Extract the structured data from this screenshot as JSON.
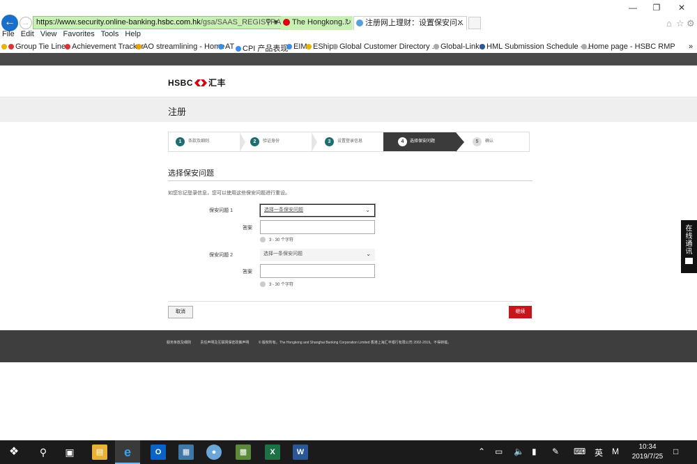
{
  "browser": {
    "url_prefix": "https://www.security.online-banking.",
    "url_host": "hsbc.com.hk",
    "url_rest": "/gsa/SAAS_REGISTRATI",
    "tab1_label": "The Hongkong...",
    "tab2_label": "注册网上理财：设置保安问...",
    "menu": [
      "File",
      "Edit",
      "View",
      "Favorites",
      "Tools",
      "Help"
    ],
    "favorites": [
      "Group Tie Lines",
      "Achievement Tracker",
      "AO streamlining - Home",
      "AT",
      "CPI 产品表现",
      "EIM",
      "EShip",
      "Global Customer Directory ...",
      "Global-Links",
      "HML Submission Schedule - ...",
      "Home page - HSBC RMP"
    ]
  },
  "header": {
    "logo_text": "HSBC",
    "logo_cn": "汇丰"
  },
  "page": {
    "title": "注册",
    "steps": [
      {
        "num": "1",
        "label": "条款及细则",
        "state": "done"
      },
      {
        "num": "2",
        "label": "验证身份",
        "state": "done"
      },
      {
        "num": "3",
        "label": "设置登录信息",
        "state": "done"
      },
      {
        "num": "4",
        "label": "选择保安问题",
        "state": "active"
      },
      {
        "num": "5",
        "label": "确认",
        "state": "todo"
      }
    ],
    "section_title": "选择保安问题",
    "intro": "如您忘记登录信息，您可以使用这些保安问题进行重设。",
    "q1_label": "保安问题 1",
    "q1_placeholder": "选择一条保安问题",
    "answer1_label": "答案",
    "hint1": "3 - 30 个字符",
    "q2_label": "保安问题 2",
    "q2_placeholder": "选择一条保安问题",
    "answer2_label": "答案",
    "hint2": "3 - 30 个字符",
    "cancel": "取消",
    "continue": "继续"
  },
  "footer": {
    "links": [
      "服务条款及细则",
      "责任声明及互联网保密政策声明",
      "© 版权所有。The Hongkong and Shanghai Banking Corporation Limited 香港上海汇丰银行有限公司 2002-2019。不得转载。"
    ]
  },
  "chat": {
    "label": [
      "在",
      "线",
      "通",
      "讯"
    ]
  },
  "taskbar": {
    "ime": "英",
    "time": "10:34",
    "date": "2019/7/25"
  }
}
